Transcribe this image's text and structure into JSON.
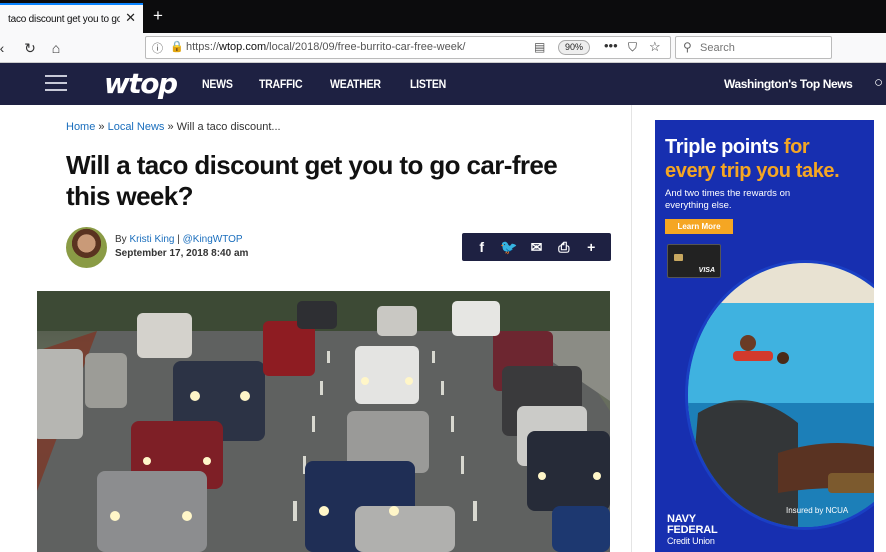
{
  "browser": {
    "tab_title": "taco discount get you to go car-free this week",
    "tab_close": "✕",
    "new_tab": "+",
    "back": "‹",
    "reload": "↻",
    "home": "⌂",
    "url_prefix": "https://",
    "url_host": "wtop.com",
    "url_path": "/local/2018/09/free-burrito-car-free-week/",
    "zoom": "90%",
    "more": "•••",
    "search_placeholder": "Search"
  },
  "site": {
    "logo": "wtop",
    "nav": [
      "NEWS",
      "TRAFFIC",
      "WEATHER",
      "LISTEN"
    ],
    "tagline": "Washington's Top News"
  },
  "article": {
    "breadcrumb": {
      "home": "Home",
      "sep1": " » ",
      "section": "Local News",
      "sep2": " » ",
      "current": "Will a taco discount..."
    },
    "headline": "Will a taco discount get you to go car-free this week?",
    "byline_prefix": "By ",
    "author": "Kristi King",
    "byline_sep": " | ",
    "handle": "@KingWTOP",
    "date": "September 17, 2018 8:40 am",
    "share": [
      "f",
      "🐦",
      "✉",
      "⎙",
      "+"
    ]
  },
  "ad": {
    "line1_a": "Triple points ",
    "line1_b": "for",
    "line2": "every trip you take.",
    "sub": "And two times the rewards on everything else.",
    "button": "Learn More",
    "card_brand": "VISA",
    "brand_1": "NAVY",
    "brand_2": "FEDERAL",
    "brand_3": "Credit Union",
    "ncua": "Insured by NCUA"
  },
  "colors": {
    "header_bg": "#1e2142",
    "link": "#1a6ebd",
    "ad_bg": "#172fb0",
    "ad_accent": "#f5a623"
  }
}
